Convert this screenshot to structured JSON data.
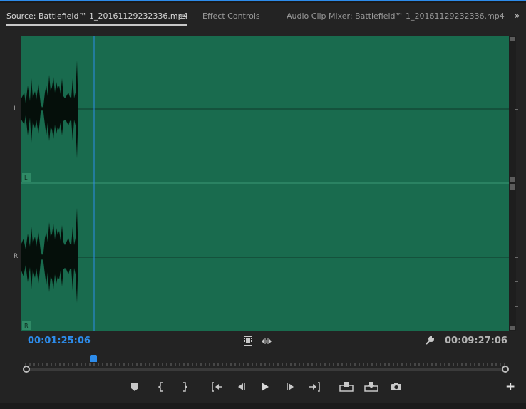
{
  "tabs": {
    "source": "Source: Battlefield™ 1_20161129232336.mp4",
    "effect_controls": "Effect Controls",
    "audio_clip_mixer": "Audio Clip Mixer: Battlefield™ 1_20161129232336.mp4",
    "menu_glyph": "≡",
    "overflow_glyph": "»"
  },
  "channels": {
    "left": "L",
    "right": "R",
    "left_tag": "L",
    "right_tag": "R"
  },
  "timecode": {
    "current": "00:01:25:06",
    "duration": "00:09:27:06"
  },
  "colors": {
    "waveform_bg": "#196b4e",
    "playhead": "#2d8ceb",
    "timecode_current": "#2d8ceb"
  },
  "icons": {
    "film_strip": "film-strip-icon",
    "audio_drag": "audio-drag-icon",
    "settings": "wrench-icon",
    "add": "+"
  },
  "transport": [
    {
      "name": "add-marker-button",
      "glyph": "⬟"
    },
    {
      "name": "mark-in-button",
      "glyph": "{"
    },
    {
      "name": "mark-out-button",
      "glyph": "}"
    },
    {
      "name": "go-to-in-button",
      "glyph": "{←"
    },
    {
      "name": "step-back-button",
      "glyph": "◀|"
    },
    {
      "name": "play-button",
      "glyph": "▶"
    },
    {
      "name": "step-forward-button",
      "glyph": "|▶"
    },
    {
      "name": "go-to-out-button",
      "glyph": "→}"
    },
    {
      "name": "insert-button",
      "glyph": "⧉"
    },
    {
      "name": "overwrite-button",
      "glyph": "⬓"
    },
    {
      "name": "export-frame-button",
      "glyph": "📷"
    }
  ]
}
